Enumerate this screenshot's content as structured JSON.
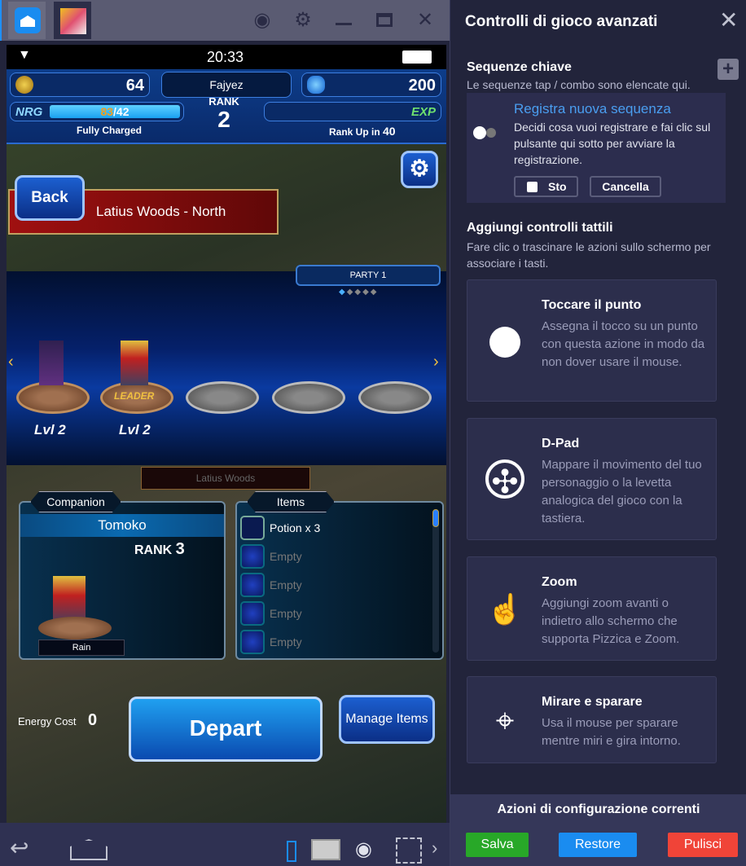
{
  "window": {
    "icons": [
      "home-icon",
      "game-tab-icon",
      "account-icon",
      "gear-icon",
      "minimize-icon",
      "maximize-icon",
      "close-icon"
    ]
  },
  "game": {
    "status": {
      "time": "20:33"
    },
    "hud": {
      "gil": "64",
      "player_name": "Fajyez",
      "gems": "200",
      "rank_label": "RANK",
      "rank": "2",
      "nrg_label": "NRG",
      "nrg_current": "83",
      "nrg_max": "/42",
      "nrg_status": "Fully Charged",
      "exp_label": "EXP",
      "rank_up_label": "Rank Up in",
      "rank_up_value": "40"
    },
    "back_label": "Back",
    "location": "Latius Woods - North",
    "party": {
      "label": "PARTY 1",
      "units": [
        {
          "level": "Lvl 2"
        },
        {
          "level": "Lvl 2",
          "badge": "LEADER"
        }
      ]
    },
    "sub_location": "Latius Woods",
    "companion": {
      "header": "Companion",
      "name": "Tomoko",
      "rank_label": "RANK",
      "rank": "3",
      "unit_name": "Rain"
    },
    "items": {
      "header": "Items",
      "rows": [
        "Potion x 3",
        "Empty",
        "Empty",
        "Empty",
        "Empty"
      ]
    },
    "energy_cost_label": "Energy Cost",
    "energy_cost": "0",
    "depart_label": "Depart",
    "manage_items_label": "Manage Items"
  },
  "panel": {
    "title": "Controlli di gioco avanzati",
    "seq_title": "Sequenze chiave",
    "seq_desc": "Le sequenze tap / combo sono elencate qui.",
    "rec_title": "Registra nuova sequenza",
    "rec_desc": "Decidi cosa vuoi registrare e fai clic sul pulsante qui sotto per avviare la registrazione.",
    "stop_label": "Sto",
    "cancel_label": "Cancella",
    "touch_title": "Aggiungi controlli tattili",
    "touch_desc": "Fare clic o trascinare le azioni sullo schermo per associare i tasti.",
    "cards": [
      {
        "title": "Toccare il punto",
        "desc": "Assegna il tocco su un punto con questa azione in modo da non dover usare il mouse."
      },
      {
        "title": "D-Pad",
        "desc": "Mappare il movimento del tuo personaggio o la levetta analogica del gioco con la tastiera."
      },
      {
        "title": "Zoom",
        "desc": "Aggiungi zoom avanti o indietro allo schermo che supporta Pizzica e Zoom."
      },
      {
        "title": "Mirare e sparare",
        "desc": "Usa il mouse per sparare mentre miri e gira intorno."
      }
    ],
    "footer_title": "Azioni di configurazione correnti",
    "save_label": "Salva",
    "restore_label": "Restore",
    "clear_label": "Pulisci",
    "colors": {
      "save": "#28a828",
      "restore": "#1a8cf0",
      "clear": "#f04438",
      "link": "#4a9ef0"
    }
  }
}
